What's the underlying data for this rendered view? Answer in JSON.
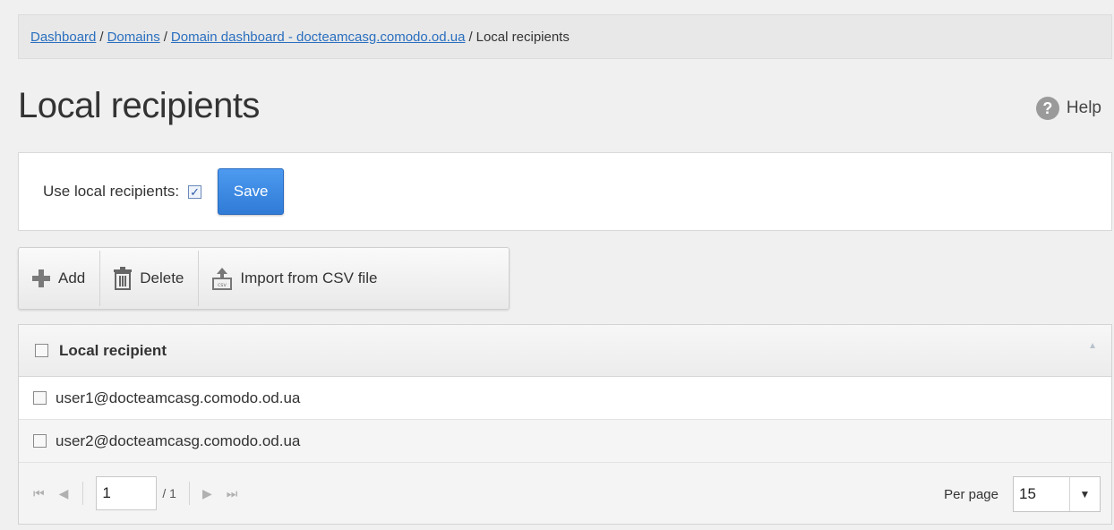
{
  "breadcrumb": {
    "items": [
      "Dashboard",
      "Domains",
      "Domain dashboard - docteamcasg.comodo.od.ua"
    ],
    "current": "Local recipients",
    "separator": "/"
  },
  "page": {
    "title": "Local recipients",
    "help_label": "Help",
    "help_icon": "?"
  },
  "settings": {
    "use_local_label": "Use local recipients:",
    "use_local_checked": true,
    "save_label": "Save"
  },
  "toolbar": {
    "add_label": "Add",
    "delete_label": "Delete",
    "import_label": "Import from CSV file"
  },
  "table": {
    "header": "Local recipient",
    "rows": [
      "user1@docteamcasg.comodo.od.ua",
      "user2@docteamcasg.comodo.od.ua"
    ]
  },
  "pager": {
    "current_page": "1",
    "total": "/ 1",
    "per_page_label": "Per page",
    "per_page_value": "15"
  },
  "colors": {
    "accent": "#2f7bd6",
    "link": "#2a6fbf",
    "background": "#f0f0f0"
  }
}
